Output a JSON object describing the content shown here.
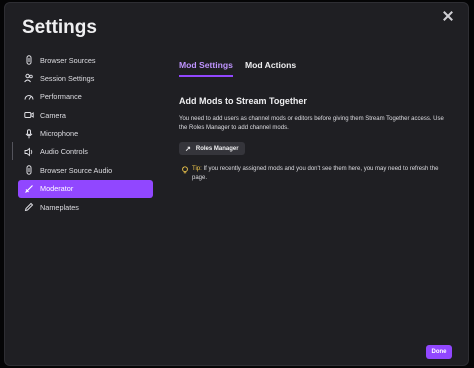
{
  "title": "Settings",
  "sidebar": {
    "items": [
      {
        "label": "Browser Sources",
        "icon": "link-icon"
      },
      {
        "label": "Session Settings",
        "icon": "users-icon"
      },
      {
        "label": "Performance",
        "icon": "gauge-icon"
      },
      {
        "label": "Camera",
        "icon": "camera-icon"
      },
      {
        "label": "Microphone",
        "icon": "microphone-icon"
      },
      {
        "label": "Audio Controls",
        "icon": "volume-icon"
      },
      {
        "label": "Browser Source Audio",
        "icon": "link-icon"
      },
      {
        "label": "Moderator",
        "icon": "sword-icon",
        "active": true
      },
      {
        "label": "Nameplates",
        "icon": "pencil-icon"
      }
    ]
  },
  "tabs": [
    {
      "label": "Mod Settings",
      "active": true
    },
    {
      "label": "Mod Actions",
      "active": false
    }
  ],
  "main": {
    "heading": "Add Mods to Stream Together",
    "description": "You need to add users as channel mods or editors before giving them Stream Together access. Use the Roles Manager to add channel mods.",
    "roles_button": "Roles Manager",
    "tip_label": "Tip:",
    "tip_text": "If you recently assigned mods and you don't see them here, you may need to refresh the page."
  },
  "footer": {
    "done_label": "Done"
  },
  "colors": {
    "accent": "#9147ff",
    "tab_active": "#bf94ff",
    "background": "#1f1f23"
  }
}
